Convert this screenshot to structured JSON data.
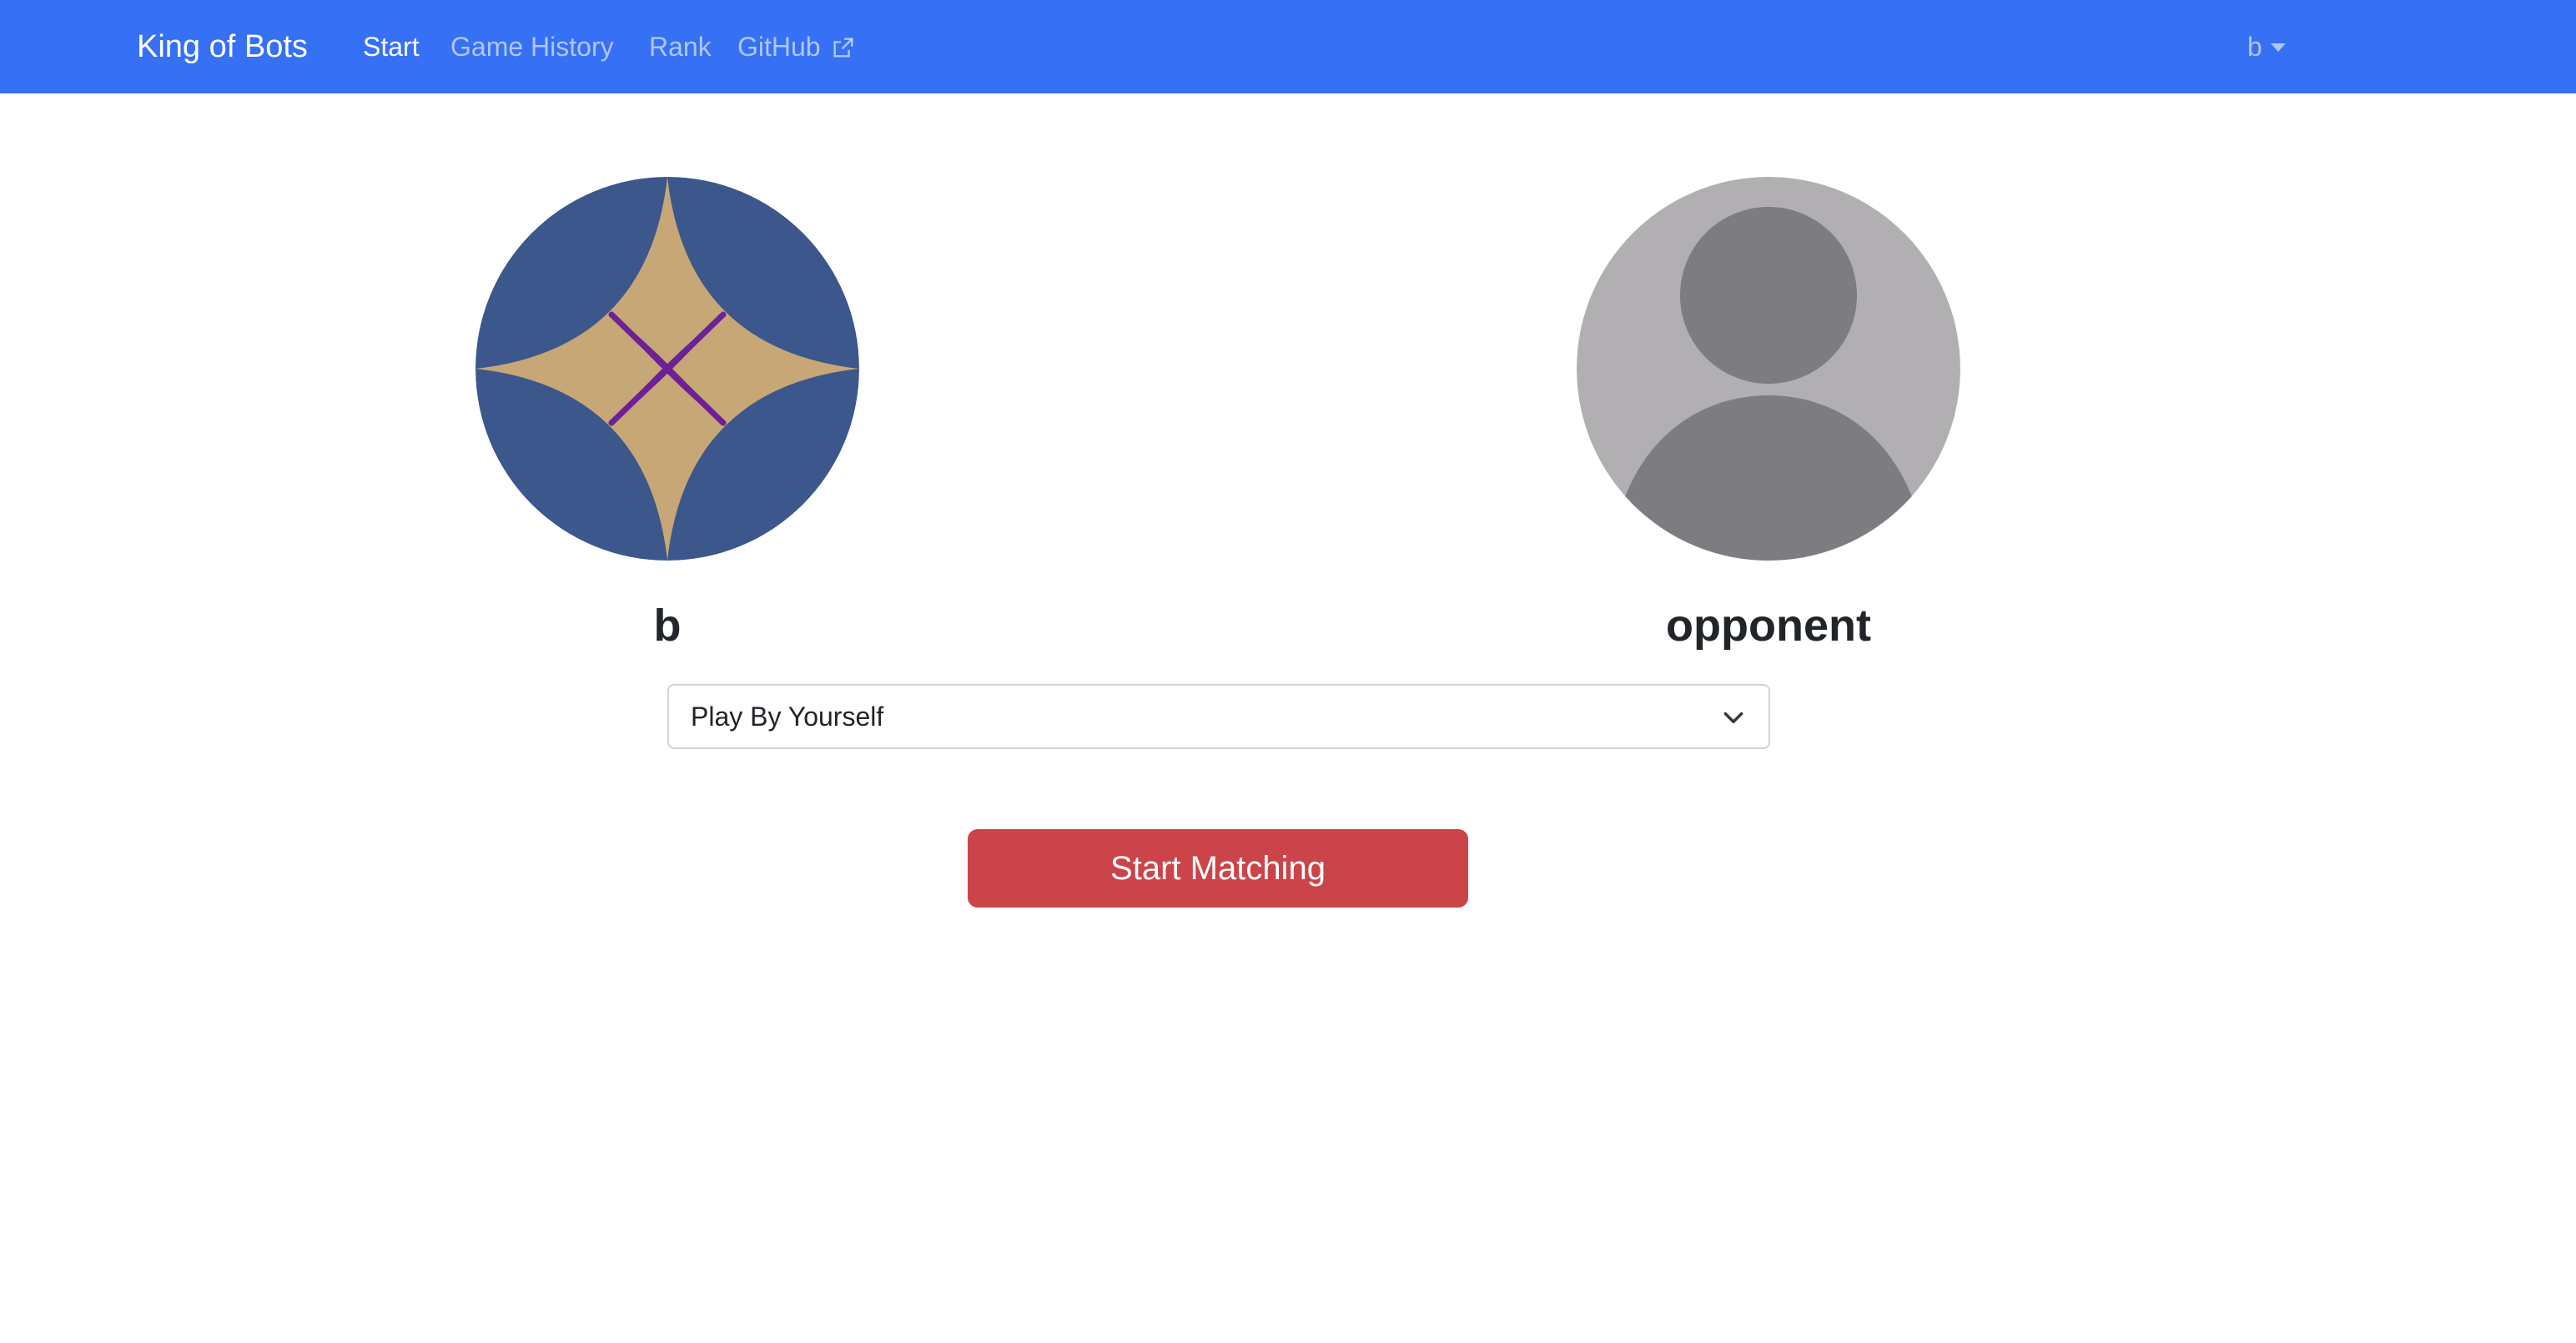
{
  "navbar": {
    "brand": "King of Bots",
    "items": [
      {
        "label": "Start",
        "active": true
      },
      {
        "label": "Game History",
        "active": false
      },
      {
        "label": "Rank",
        "active": false
      },
      {
        "label": "GitHub",
        "active": false,
        "icon": "external-link-icon"
      }
    ],
    "user": "b",
    "user_icon": "caret-down-icon",
    "colors": {
      "background": "#3570f5"
    }
  },
  "players": {
    "self": {
      "name": "b",
      "avatar": "self-avatar-icon"
    },
    "opponent": {
      "name": "opponent",
      "avatar": "default-user-avatar-icon"
    }
  },
  "mode_select": {
    "selected": "Play By Yourself",
    "icon": "chevron-down-icon"
  },
  "start_button": {
    "label": "Start Matching",
    "color": "#cb444a"
  }
}
